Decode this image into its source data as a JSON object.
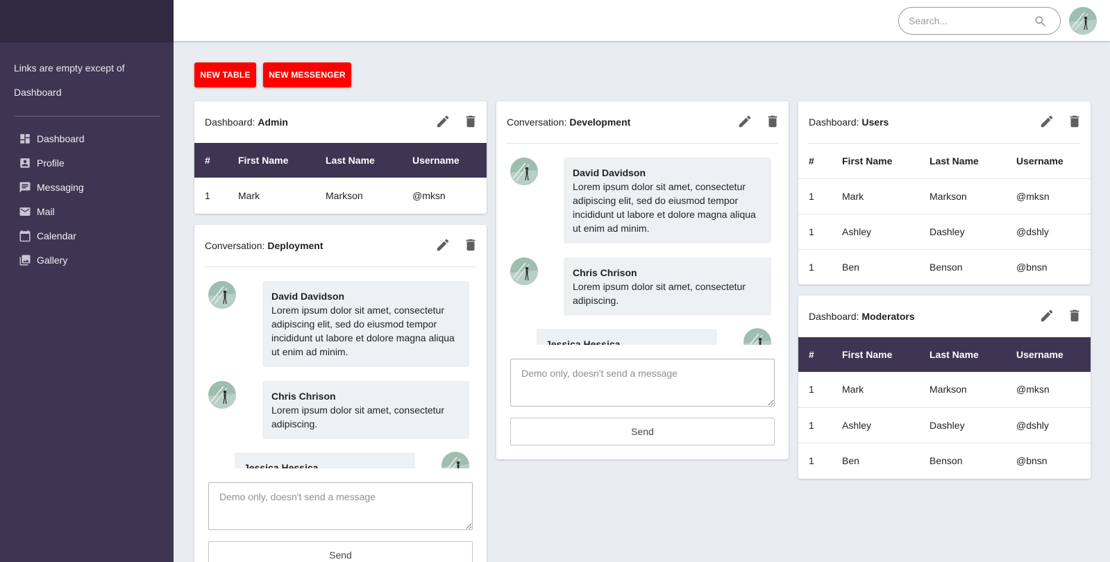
{
  "sidebar": {
    "note": "Links are empty except of Dashboard",
    "items": [
      {
        "label": "Dashboard",
        "icon": "dashboard-icon"
      },
      {
        "label": "Profile",
        "icon": "profile-icon"
      },
      {
        "label": "Messaging",
        "icon": "messaging-icon"
      },
      {
        "label": "Mail",
        "icon": "mail-icon"
      },
      {
        "label": "Calendar",
        "icon": "calendar-icon"
      },
      {
        "label": "Gallery",
        "icon": "gallery-icon"
      }
    ]
  },
  "topbar": {
    "search_placeholder": "Search...",
    "search_icon": "search-icon",
    "avatar_icon": "user-avatar"
  },
  "actions": {
    "new_table": "NEW TABLE",
    "new_messenger": "NEW MESSENGER"
  },
  "colors": {
    "sidebar": "#3d3551",
    "sidebar_top": "#302a42",
    "accent_red": "#ff0000",
    "table_header_dark": "#3d3551",
    "message_bubble": "#eef1f4",
    "page_background": "#e9ecf1"
  },
  "table_columns": [
    "#",
    "First Name",
    "Last Name",
    "Username"
  ],
  "cards": {
    "admin": {
      "prefix": "Dashboard:",
      "name": "Admin",
      "rows": [
        [
          "1",
          "Mark",
          "Markson",
          "@mksn"
        ]
      ]
    },
    "users": {
      "prefix": "Dashboard:",
      "name": "Users",
      "rows": [
        [
          "1",
          "Mark",
          "Markson",
          "@mksn"
        ],
        [
          "1",
          "Ashley",
          "Dashley",
          "@dshly"
        ],
        [
          "1",
          "Ben",
          "Benson",
          "@bnsn"
        ]
      ]
    },
    "moderators": {
      "prefix": "Dashboard:",
      "name": "Moderators",
      "rows": [
        [
          "1",
          "Mark",
          "Markson",
          "@mksn"
        ],
        [
          "1",
          "Ashley",
          "Dashley",
          "@dshly"
        ],
        [
          "1",
          "Ben",
          "Benson",
          "@bnsn"
        ]
      ]
    },
    "deployment": {
      "prefix": "Conversation:",
      "name": "Deployment",
      "messages": [
        {
          "author": "David Davidson",
          "text": "Lorem ipsum dolor sit amet, consectetur adipiscing elit, sed do eiusmod tempor incididunt ut labore et dolore magna aliqua ut enim ad minim."
        },
        {
          "author": "Chris Chrison",
          "text": "Lorem ipsum dolor sit amet, consectetur adipiscing."
        },
        {
          "author": "Jessica Hessica",
          "text": ""
        }
      ],
      "input_placeholder": "Demo only, doesn't send a message",
      "send_label": "Send"
    },
    "development": {
      "prefix": "Conversation:",
      "name": "Development",
      "messages": [
        {
          "author": "David Davidson",
          "text": "Lorem ipsum dolor sit amet, consectetur adipiscing elit, sed do eiusmod tempor incididunt ut labore et dolore magna aliqua ut enim ad minim."
        },
        {
          "author": "Chris Chrison",
          "text": "Lorem ipsum dolor sit amet, consectetur adipiscing."
        },
        {
          "author": "Jessica Hessica",
          "text": ""
        }
      ],
      "input_placeholder": "Demo only, doesn't send a message",
      "send_label": "Send"
    }
  }
}
